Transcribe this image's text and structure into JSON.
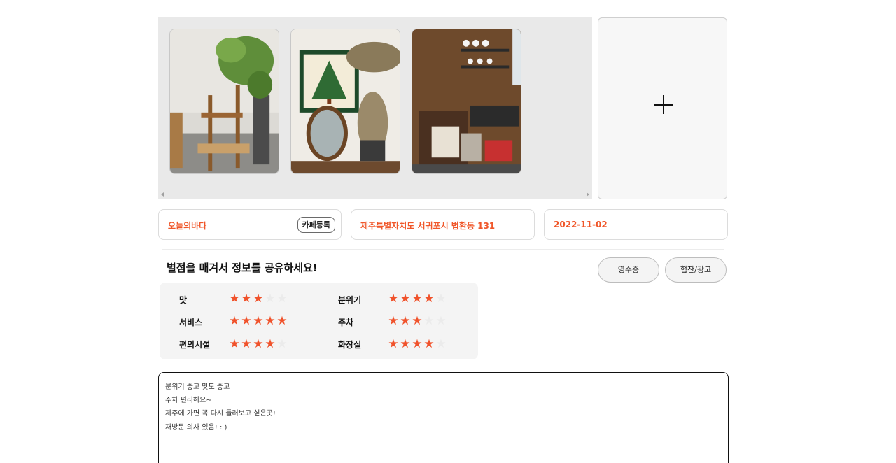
{
  "gallery": {
    "photos": [
      {
        "alt": ""
      },
      {
        "alt": ""
      },
      {
        "alt": ""
      }
    ],
    "add_icon": "plus-icon"
  },
  "info": {
    "cafe_name": "오늘의바다",
    "cafe_register_label": "카페등록",
    "address": "제주특별자치도 서귀포시 법환동 131",
    "date": "2022-11-02"
  },
  "rating_section": {
    "title": "별점을 매겨서 정보를 공유하세요!",
    "receipt_label": "영수증",
    "sponsor_label": "협찬/광고",
    "items": [
      {
        "label": "맛",
        "stars": 3
      },
      {
        "label": "분위기",
        "stars": 4
      },
      {
        "label": "서비스",
        "stars": 5
      },
      {
        "label": "주차",
        "stars": 3
      },
      {
        "label": "편의시설",
        "stars": 4
      },
      {
        "label": "화장실",
        "stars": 4
      }
    ],
    "max_stars": 5
  },
  "review": {
    "lines": [
      "분위기 좋고 맛도 좋고",
      "주차 편리해요~",
      "제주에 가면 꼭 다시 들러보고 싶은곳!",
      "재방문 의사 있음! : )"
    ]
  },
  "colors": {
    "accent": "#f0572a",
    "star_on": "#f0522b",
    "star_off": "#ebebeb"
  }
}
